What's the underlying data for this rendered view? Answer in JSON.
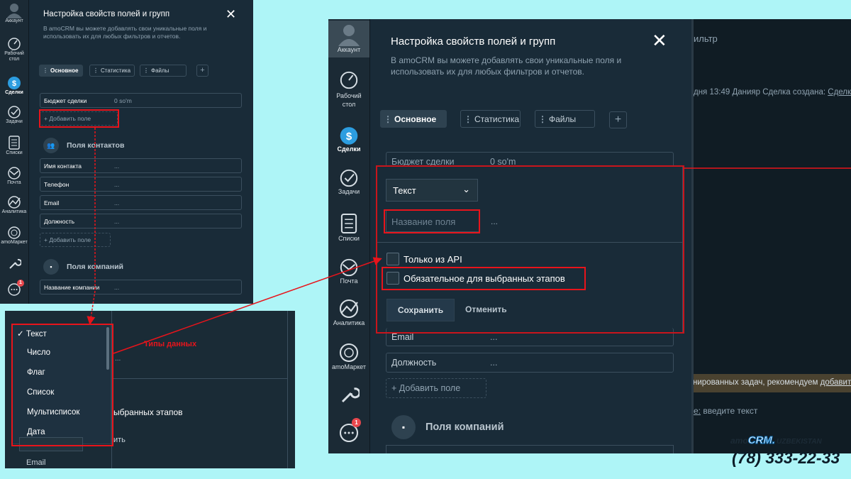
{
  "sidebar": {
    "account": "Аккаунт",
    "desk": "Рабочий стол",
    "deals": "Сделки",
    "tasks": "Задачи",
    "lists": "Списки",
    "mail": "Почта",
    "analytics": "Аналитика",
    "market": "amoМаркет",
    "chat_badge": "1"
  },
  "panel": {
    "title": "Настройка свойств полей и групп",
    "description": "В amoCRM вы можете добавлять свои уникальные поля и использовать их для любых фильтров и отчетов.",
    "tabs": [
      "Основное",
      "Статистика",
      "Файлы"
    ],
    "tab_plus": "+",
    "close": "✕"
  },
  "deal_fields": [
    {
      "label": "Бюджет сделки",
      "value": "0 so'm"
    }
  ],
  "add_field": "+ Добавить поле",
  "contacts_section": "Поля контактов",
  "contact_fields": [
    {
      "label": "Имя контакта",
      "value": "..."
    },
    {
      "label": "Телефон",
      "value": "..."
    },
    {
      "label": "Email",
      "value": "..."
    },
    {
      "label": "Должность",
      "value": "..."
    }
  ],
  "companies_section": "Поля компаний",
  "company_fields": [
    {
      "label": "Название компании",
      "value": "..."
    }
  ],
  "dropdown": {
    "checkmark": "✓",
    "options": [
      "Текст",
      "Число",
      "Флаг",
      "Список",
      "Мультисписок",
      "Дата"
    ],
    "bg_fragments": {
      "stages": "ыбранных этапов",
      "cancel": "ить",
      "email": "Email",
      "dots": "..."
    }
  },
  "annotation": {
    "data_types": "Типы данных",
    "color": "#e8141b"
  },
  "editor": {
    "type_select": "Текст",
    "name_placeholder": "Название поля",
    "dots": "...",
    "api_only": "Только из API",
    "required_stages": "Обязательное для выбранных этапов",
    "save": "Сохранить",
    "cancel": "Отменить"
  },
  "background": {
    "filter": "ильтр",
    "feed_line": "дня 13:49 Данияр Сделка создана:",
    "feed_link": "Сделка #",
    "tasks_hint": "нированных задач, рекомендуем",
    "tasks_link": "добавит",
    "input_prefix": "е:",
    "input_placeholder": "введите текст"
  },
  "branding": {
    "prefix": "amo",
    "crm": "CRM.",
    "country": "UZBEKISTAN",
    "phone": "(78) 333-22-33"
  }
}
